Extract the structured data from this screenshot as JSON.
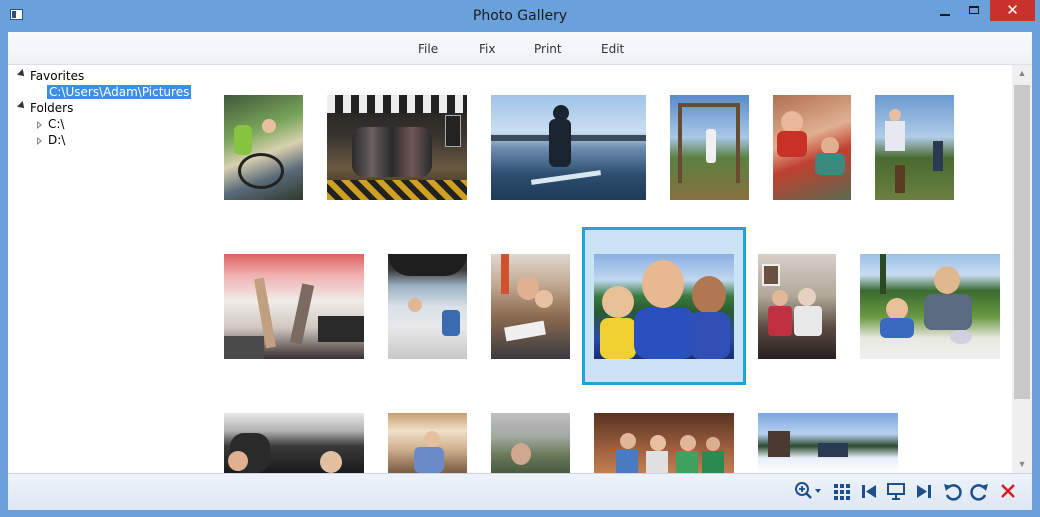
{
  "window": {
    "title": "Photo Gallery",
    "close_glyph": "✕"
  },
  "menu": {
    "items": [
      {
        "label": "File"
      },
      {
        "label": "Fix"
      },
      {
        "label": "Print"
      },
      {
        "label": "Edit"
      }
    ]
  },
  "tree": {
    "favorites": "Favorites",
    "favorite_path": "C:\\Users\\Adam\\Pictures",
    "folders": "Folders",
    "drive_c": "C:\\",
    "drive_d": "D:\\"
  },
  "gallery": {
    "photos": [
      {
        "name": "photo-kids-on-bike"
      },
      {
        "name": "photo-group-indoors"
      },
      {
        "name": "photo-paddleboard-lake"
      },
      {
        "name": "photo-playground-rings"
      },
      {
        "name": "photo-boys-in-car"
      },
      {
        "name": "photo-man-with-kids-outdoor"
      },
      {
        "name": "photo-dancing-living-room"
      },
      {
        "name": "photo-boat-ride"
      },
      {
        "name": "photo-man-with-child-reading"
      },
      {
        "name": "photo-selfie-boys",
        "selected": true
      },
      {
        "name": "photo-family-elder"
      },
      {
        "name": "photo-birthday-cake"
      },
      {
        "name": "photo-car-backseat"
      },
      {
        "name": "photo-kitchen-man"
      },
      {
        "name": "photo-man-portrait"
      },
      {
        "name": "photo-kids-lined-up"
      },
      {
        "name": "photo-snowy-mountain"
      }
    ]
  },
  "toolbar": {
    "icons": [
      "zoom-icon",
      "grid-view-icon",
      "previous-icon",
      "slideshow-icon",
      "next-icon",
      "rotate-left-icon",
      "rotate-right-icon",
      "delete-icon"
    ]
  },
  "colors": {
    "frame": "#6aa1db",
    "selection": "#26a0da",
    "close": "#c7322b"
  }
}
